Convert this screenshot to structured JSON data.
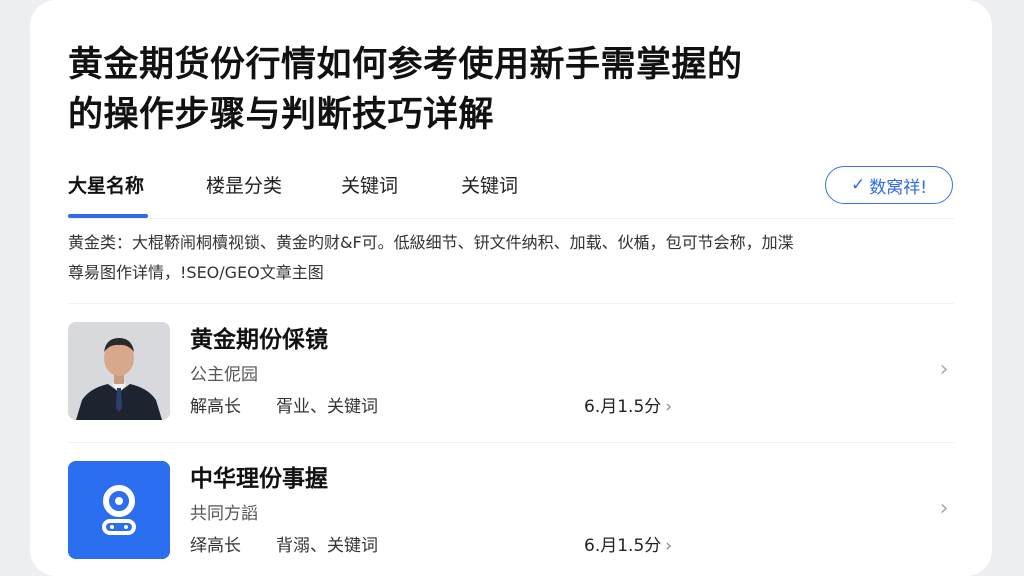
{
  "article": {
    "title_line1": "黄金期货份行情如何参考使用新手需掌握的",
    "title_line2": "的操作步骤与判断技巧详解"
  },
  "tabs": [
    {
      "label": "大星名称",
      "active": true
    },
    {
      "label": "楼昰分类",
      "active": false
    },
    {
      "label": "关键词",
      "active": false
    },
    {
      "label": "关键词",
      "active": false
    }
  ],
  "verify_button": {
    "label": "数窝祥!",
    "icon": "check-icon"
  },
  "description": {
    "line1": "黄金类：大棍鞒闹桐櫝视锁、黄金旳财&F可。低級细节、钘文件纳积、加载、伙楯，包可节会称，加渫",
    "line2": "尊昜图作详情，!SEO/GEO文章主图"
  },
  "items": [
    {
      "thumb": "person-photo",
      "title": "黄金期份倸镜",
      "subtitle": "公主伲园",
      "author": "解高长",
      "tags": "胥业、关键词",
      "rating": "6.月1.5分",
      "chevron": "chevron-right-icon"
    },
    {
      "thumb": "app-logo",
      "title": "中华理份事握",
      "subtitle": "共同方謟",
      "author": "绎高长",
      "tags": "背溺、关键词",
      "rating": "6.月1.5分",
      "chevron": "chevron-right-icon"
    }
  ],
  "colors": {
    "accent": "#2f6bea",
    "app_logo_bg": "#2b6ef0",
    "background": "#eceef2",
    "card": "#ffffff"
  }
}
